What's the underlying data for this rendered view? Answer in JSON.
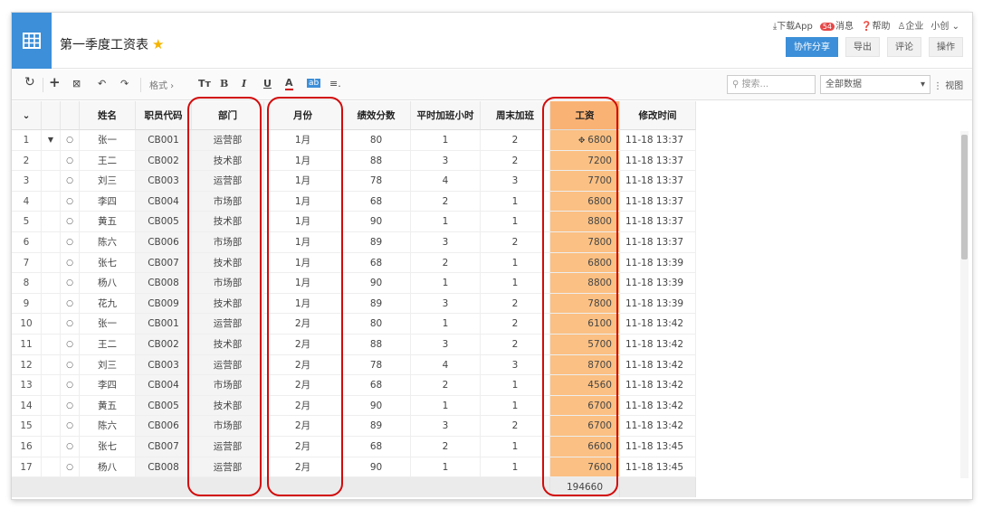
{
  "header": {
    "title": "第一季度工资表",
    "links": [
      "下载App",
      "消息",
      "帮助",
      "企业",
      "小创"
    ],
    "message_count": "54",
    "buttons": [
      "协作分享",
      "导出",
      "评论",
      "操作"
    ]
  },
  "toolbar": {
    "format_label": "格式",
    "search_placeholder": "搜索...",
    "filter_value": "全部数据",
    "view_label": "视图"
  },
  "table": {
    "columns": [
      "姓名",
      "职员代码",
      "部门",
      "月份",
      "绩效分数",
      "平时加班小时",
      "周末加班",
      "工资",
      "修改时间"
    ],
    "rows": [
      [
        "1",
        "张一",
        "CB001",
        "运营部",
        "1月",
        "80",
        "1",
        "2",
        "6800",
        "11-18 13:37"
      ],
      [
        "2",
        "王二",
        "CB002",
        "技术部",
        "1月",
        "88",
        "3",
        "2",
        "7200",
        "11-18 13:37"
      ],
      [
        "3",
        "刘三",
        "CB003",
        "运营部",
        "1月",
        "78",
        "4",
        "3",
        "7700",
        "11-18 13:37"
      ],
      [
        "4",
        "李四",
        "CB004",
        "市场部",
        "1月",
        "68",
        "2",
        "1",
        "6800",
        "11-18 13:37"
      ],
      [
        "5",
        "黄五",
        "CB005",
        "技术部",
        "1月",
        "90",
        "1",
        "1",
        "8800",
        "11-18 13:37"
      ],
      [
        "6",
        "陈六",
        "CB006",
        "市场部",
        "1月",
        "89",
        "3",
        "2",
        "7800",
        "11-18 13:37"
      ],
      [
        "7",
        "张七",
        "CB007",
        "技术部",
        "1月",
        "68",
        "2",
        "1",
        "6800",
        "11-18 13:39"
      ],
      [
        "8",
        "杨八",
        "CB008",
        "市场部",
        "1月",
        "90",
        "1",
        "1",
        "8800",
        "11-18 13:39"
      ],
      [
        "9",
        "花九",
        "CB009",
        "技术部",
        "1月",
        "89",
        "3",
        "2",
        "7800",
        "11-18 13:39"
      ],
      [
        "10",
        "张一",
        "CB001",
        "运营部",
        "2月",
        "80",
        "1",
        "2",
        "6100",
        "11-18 13:42"
      ],
      [
        "11",
        "王二",
        "CB002",
        "技术部",
        "2月",
        "88",
        "3",
        "2",
        "5700",
        "11-18 13:42"
      ],
      [
        "12",
        "刘三",
        "CB003",
        "运营部",
        "2月",
        "78",
        "4",
        "3",
        "8700",
        "11-18 13:42"
      ],
      [
        "13",
        "李四",
        "CB004",
        "市场部",
        "2月",
        "68",
        "2",
        "1",
        "4560",
        "11-18 13:42"
      ],
      [
        "14",
        "黄五",
        "CB005",
        "技术部",
        "2月",
        "90",
        "1",
        "1",
        "6700",
        "11-18 13:42"
      ],
      [
        "15",
        "陈六",
        "CB006",
        "市场部",
        "2月",
        "89",
        "3",
        "2",
        "6700",
        "11-18 13:42"
      ],
      [
        "16",
        "张七",
        "CB007",
        "运营部",
        "2月",
        "68",
        "2",
        "1",
        "6600",
        "11-18 13:45"
      ],
      [
        "17",
        "杨八",
        "CB008",
        "运营部",
        "2月",
        "90",
        "1",
        "1",
        "7600",
        "11-18 13:45"
      ]
    ],
    "salary_total": "194660"
  },
  "colors": {
    "accent": "#3c8fd8",
    "highlight_column": "#fbc083",
    "annotation": "#d20a0a",
    "star": "#f5b400"
  }
}
